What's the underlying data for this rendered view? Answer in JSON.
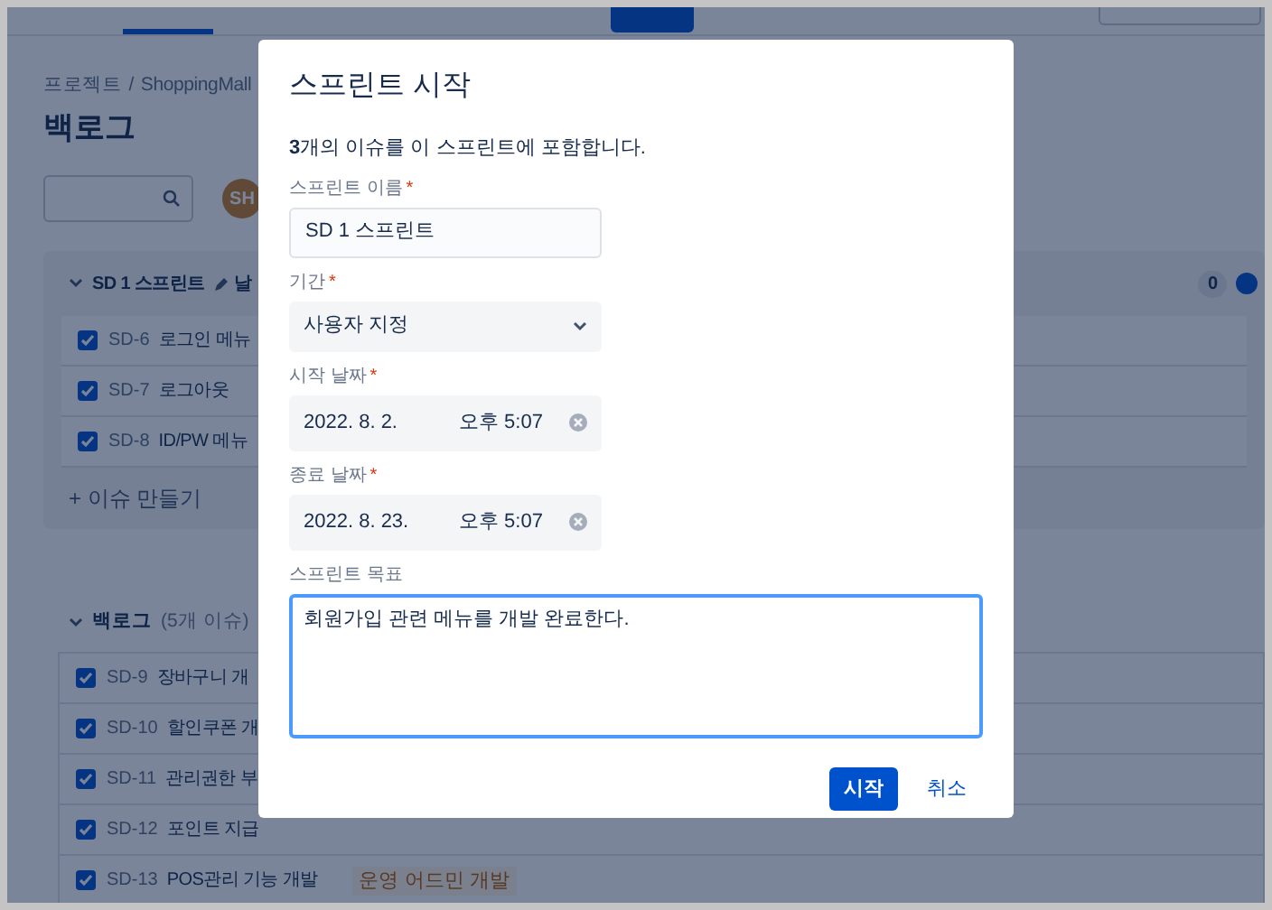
{
  "breadcrumb": [
    "프로젝트",
    "/",
    "ShoppingMall"
  ],
  "page_title": "백로그",
  "avatar": "SH",
  "sprint": {
    "name": "SD 1 스프린트",
    "edit_label": "날",
    "count": "0",
    "issues": [
      {
        "key": "SD-6",
        "summary": "로그인 메뉴",
        "checked": true
      },
      {
        "key": "SD-7",
        "summary": "로그아웃",
        "checked": true
      },
      {
        "key": "SD-8",
        "summary": "ID/PW 메뉴",
        "checked": true
      }
    ],
    "create_issue": "+ 이슈 만들기"
  },
  "backlog": {
    "name": "백로그",
    "count": "(5개 이슈)",
    "issues": [
      {
        "key": "SD-9",
        "summary": "장바구니 개",
        "checked": true
      },
      {
        "key": "SD-10",
        "summary": "할인쿠폰 개",
        "checked": true
      },
      {
        "key": "SD-11",
        "summary": "관리권한 부",
        "checked": true
      },
      {
        "key": "SD-12",
        "summary": "포인트 지급",
        "checked": true
      },
      {
        "key": "SD-13",
        "summary": "POS관리 기능 개발",
        "checked": true,
        "tag": "운영 어드민 개발"
      }
    ]
  },
  "dialog": {
    "title": "스프린트 시작",
    "intro": "**3**개의 이슈를 이 스프린트에 포함합니다.",
    "fields": [
      {
        "kind": "text",
        "label": "스프린트 이름",
        "required_mark": "*",
        "value": "SD 1 스프린트"
      },
      {
        "kind": "select",
        "label": "기간",
        "required_mark": "*",
        "value": "사용자 지정"
      },
      {
        "kind": "datetime",
        "label": "시작 날짜",
        "required_mark": "*",
        "value": "2022. 8. 2.",
        "time": "오후 5:07"
      },
      {
        "kind": "datetime",
        "label": "종료 날짜",
        "required_mark": "*",
        "value": "2022. 8. 23.",
        "time": "오후 5:07"
      },
      {
        "kind": "textarea",
        "label": "스프린트 목표",
        "value": "회원가입 관련 메뉴를 개발 완료한다.",
        "focused": true
      }
    ],
    "buttons": [
      {
        "kind": "primary",
        "label": "시작"
      },
      {
        "kind": "link",
        "label": "취소"
      }
    ]
  }
}
